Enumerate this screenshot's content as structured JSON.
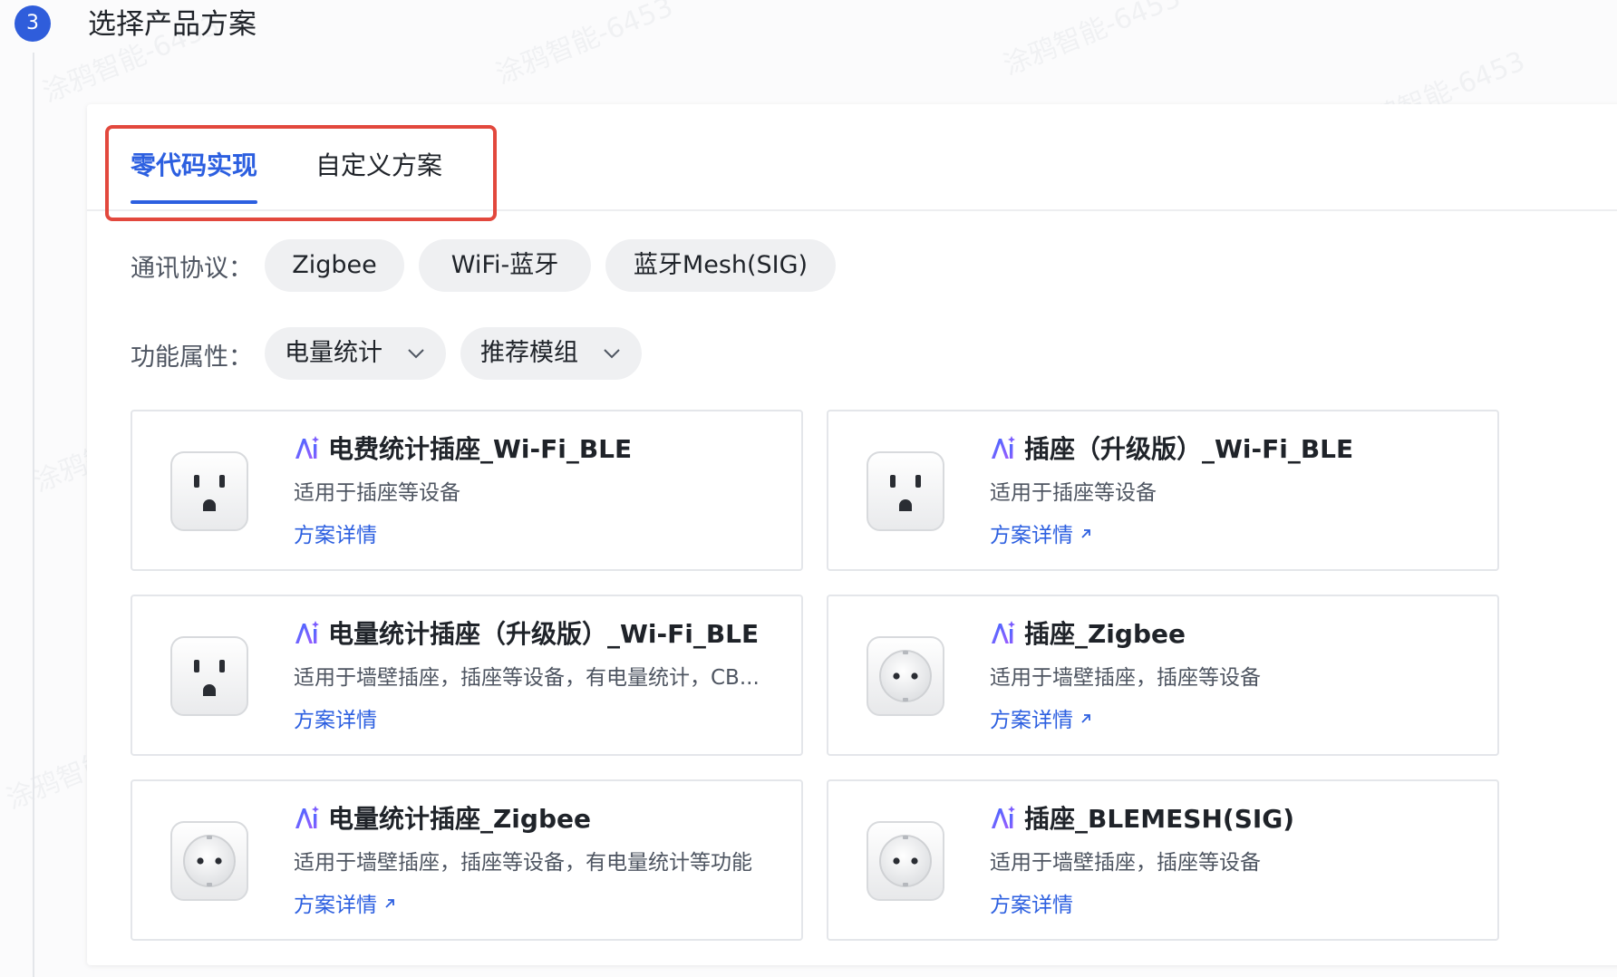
{
  "step": {
    "number": "3",
    "title": "选择产品方案"
  },
  "tabs": [
    {
      "label": "零代码实现",
      "active": true
    },
    {
      "label": "自定义方案",
      "active": false
    }
  ],
  "filters": {
    "protocol_label": "通讯协议：",
    "protocols": [
      "Zigbee",
      "WiFi-蓝牙",
      "蓝牙Mesh(SIG)"
    ],
    "function_label": "功能属性：",
    "function_dropdowns": [
      "电量统计",
      "推荐模组"
    ]
  },
  "watermark_text": "涂鸦智能-6453",
  "colors": {
    "primary": "#2c5fe0",
    "highlight_border": "#e2483d",
    "step_badge": "#2f5ddb"
  },
  "cards": [
    {
      "title": "电费统计插座_Wi-Fi_BLE",
      "desc": "适用于插座等设备",
      "link": "方案详情",
      "link_external": false,
      "image": "us-outlet-icon"
    },
    {
      "title": "插座（升级版）_Wi-Fi_BLE",
      "desc": "适用于插座等设备",
      "link": "方案详情",
      "link_external": true,
      "image": "us-outlet-icon"
    },
    {
      "title": "电量统计插座（升级版）_Wi-Fi_BLE",
      "desc": "适用于墙壁插座，插座等设备，有电量统计，CB...",
      "link": "方案详情",
      "link_external": false,
      "image": "us-outlet-icon"
    },
    {
      "title": "插座_Zigbee",
      "desc": "适用于墙壁插座，插座等设备",
      "link": "方案详情",
      "link_external": true,
      "image": "eu-outlet-icon"
    },
    {
      "title": "电量统计插座_Zigbee",
      "desc": "适用于墙壁插座，插座等设备，有电量统计等功能",
      "link": "方案详情",
      "link_external": true,
      "image": "eu-outlet-icon"
    },
    {
      "title": "插座_BLEMESH(SIG)",
      "desc": "适用于墙壁插座，插座等设备",
      "link": "方案详情",
      "link_external": false,
      "image": "eu-outlet-icon"
    }
  ]
}
